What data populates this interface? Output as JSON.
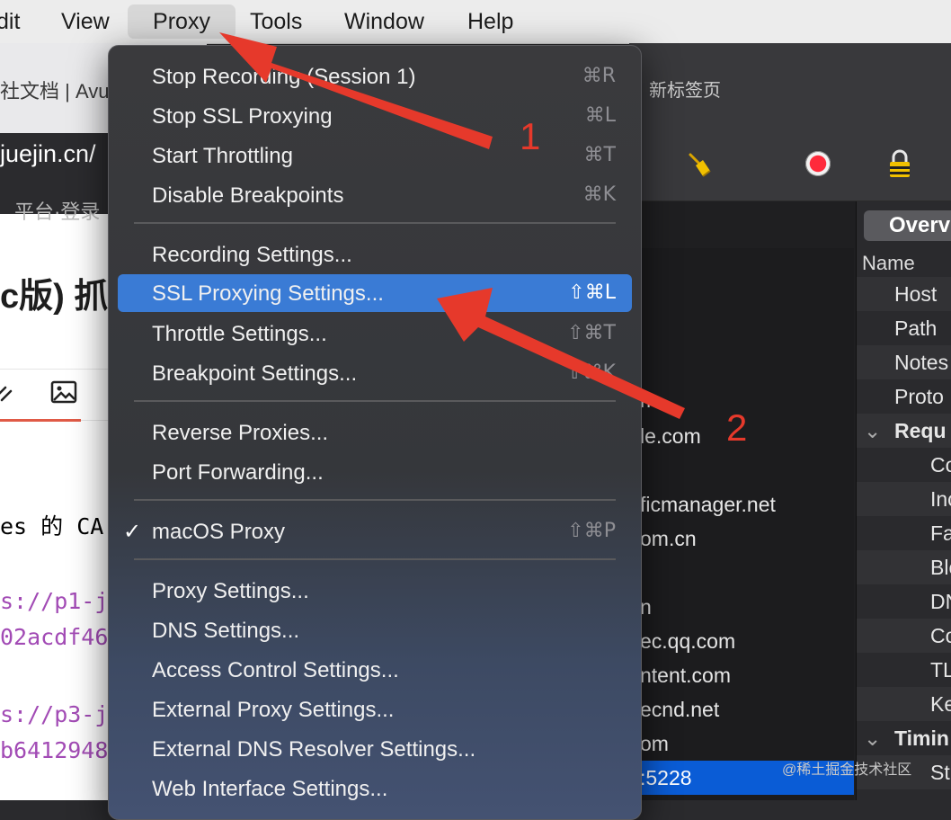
{
  "menubar": {
    "items": [
      {
        "label": "dit"
      },
      {
        "label": "View"
      },
      {
        "label": "Proxy"
      },
      {
        "label": "Tools"
      },
      {
        "label": "Window"
      },
      {
        "label": "Help"
      }
    ]
  },
  "browser": {
    "tab_title": "社文档 | Avu",
    "url": "juejin.cn/",
    "bookmark": "平台·登录",
    "doc_title": "c版) 抓",
    "code_lines": [
      {
        "text": "es 的 CA",
        "color": "#222222"
      },
      {
        "text": "s://p1-j",
        "color": "#a24bb5"
      },
      {
        "text": "02acdf46",
        "color": "#a24bb5"
      },
      {
        "text": "s://p3-j",
        "color": "#a24bb5"
      },
      {
        "text": "b6412948",
        "color": "#a24bb5"
      }
    ]
  },
  "right_window": {
    "new_tab": "新标签页",
    "hosts": [
      "m",
      "le.com",
      "ficmanager.net",
      "om.cn",
      "n",
      "ec.qq.com",
      "ntent.com",
      "ecnd.net",
      "om",
      ":5228"
    ],
    "overview_label": "Overv",
    "name_header": "Name",
    "detail_rows": [
      "Host",
      "Path",
      "Notes",
      "Proto"
    ],
    "requests_header": "Requ",
    "request_rows": [
      "Co",
      "Inc",
      "Fa",
      "Blo",
      "DN",
      "Co",
      "TL",
      "Ke"
    ],
    "timing_header": "Timin",
    "last_row": "St"
  },
  "menu": {
    "items": [
      {
        "label": "Stop Recording (Session 1)",
        "shortcut": "⌘R"
      },
      {
        "label": "Stop SSL Proxying",
        "shortcut": "⌘L"
      },
      {
        "label": "Start Throttling",
        "shortcut": "⌘T"
      },
      {
        "label": "Disable Breakpoints",
        "shortcut": "⌘K"
      },
      {
        "label": "Recording Settings..."
      },
      {
        "label": "SSL Proxying Settings...",
        "shortcut": "⇧⌘L",
        "highlighted": true
      },
      {
        "label": "Throttle Settings...",
        "shortcut": "⇧⌘T"
      },
      {
        "label": "Breakpoint Settings...",
        "shortcut": "⇧⌘K"
      },
      {
        "label": "Reverse Proxies..."
      },
      {
        "label": "Port Forwarding..."
      },
      {
        "label": "macOS Proxy",
        "shortcut": "⇧⌘P",
        "checked": true
      },
      {
        "label": "Proxy Settings..."
      },
      {
        "label": "DNS Settings..."
      },
      {
        "label": "Access Control Settings..."
      },
      {
        "label": "External Proxy Settings..."
      },
      {
        "label": "External DNS Resolver Settings..."
      },
      {
        "label": "Web Interface Settings..."
      }
    ]
  },
  "annotations": {
    "num1": "1",
    "num2": "2",
    "arrow_color": "#e6392b"
  },
  "watermark": "@稀土掘金技术社区"
}
